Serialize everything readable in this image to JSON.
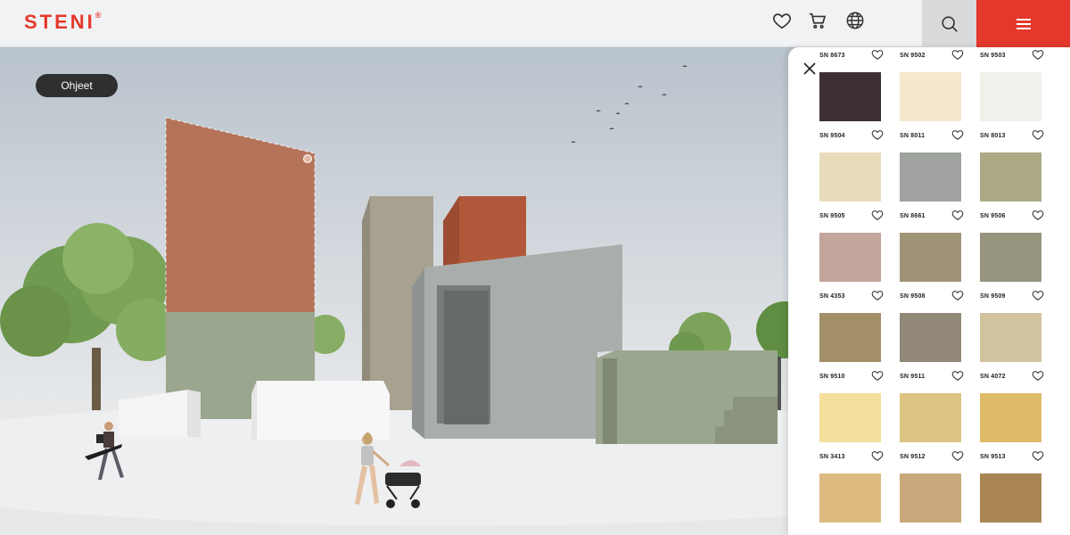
{
  "header": {
    "logo": "STENI",
    "logo_mark": "®",
    "icons": [
      "heart-icon",
      "cart-icon",
      "globe-icon",
      "search-icon",
      "menu-icon"
    ]
  },
  "scene": {
    "guide_button": "Ohjeet"
  },
  "colors": {
    "brand_red": "#e3382b",
    "facade_highlight": "#b5735a",
    "facade_green": "#9ba68e"
  },
  "swatches": [
    {
      "code": "SN 8673",
      "color": "#3d2f33"
    },
    {
      "code": "SN 9502",
      "color": "#f4e8cf"
    },
    {
      "code": "SN 9503",
      "color": "#f1f0ea"
    },
    {
      "code": "SN 9504",
      "color": "#e8dcbd"
    },
    {
      "code": "SN 8011",
      "color": "#9fa29e"
    },
    {
      "code": "SN 8013",
      "color": "#ada985"
    },
    {
      "code": "SN 9505",
      "color": "#c2a59b"
    },
    {
      "code": "SN 8661",
      "color": "#9f9478"
    },
    {
      "code": "SN 9506",
      "color": "#979580"
    },
    {
      "code": "SN 4353",
      "color": "#a28f69"
    },
    {
      "code": "SN 9508",
      "color": "#928878"
    },
    {
      "code": "SN 9509",
      "color": "#d1c39e"
    },
    {
      "code": "SN 9510",
      "color": "#f4df9c"
    },
    {
      "code": "SN 9511",
      "color": "#dcc482"
    },
    {
      "code": "SN 4072",
      "color": "#ddbb68"
    },
    {
      "code": "SN 3413",
      "color": "#ddbb80"
    },
    {
      "code": "SN 9512",
      "color": "#c8a87a"
    },
    {
      "code": "SN 9513",
      "color": "#a98553"
    }
  ]
}
